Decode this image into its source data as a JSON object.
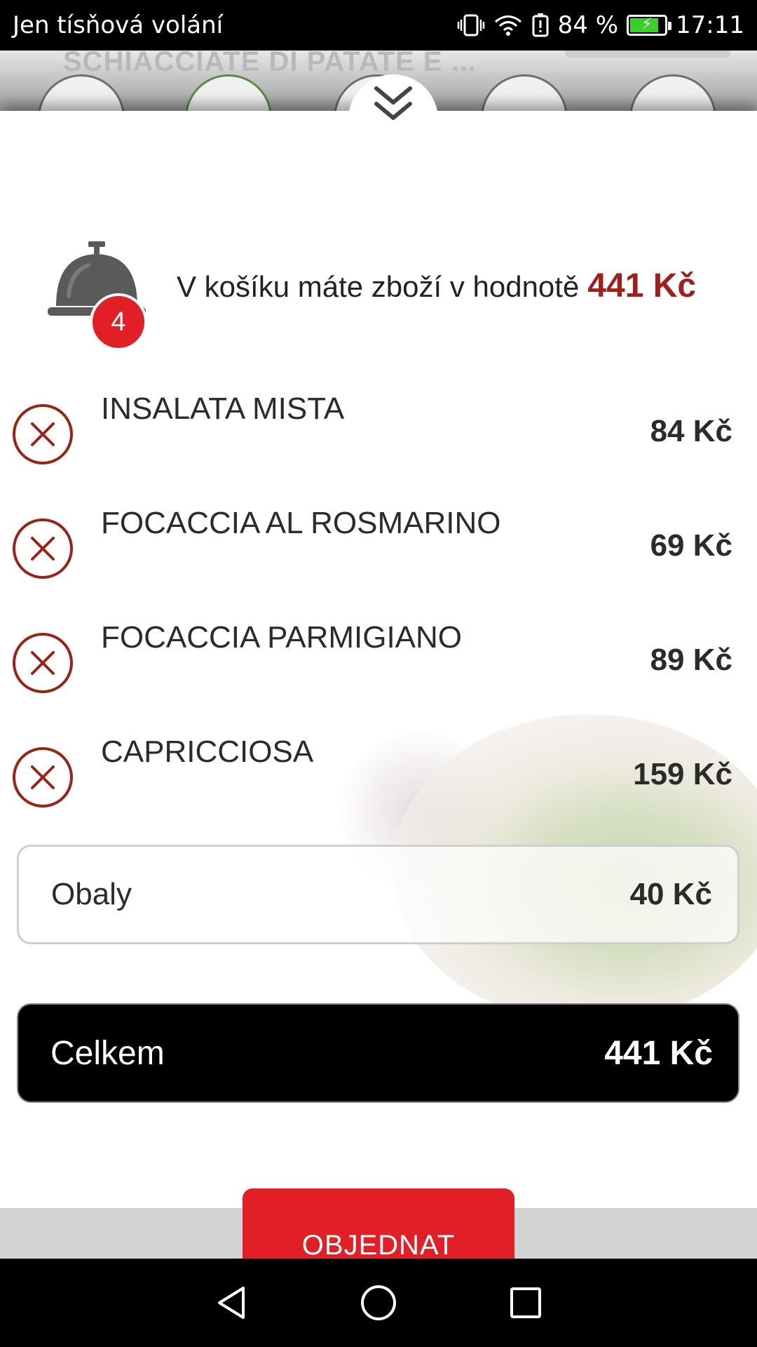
{
  "status_bar": {
    "carrier": "Jen tísňová volání",
    "battery_percent": "84 %",
    "time": "17:11",
    "battery_level": 0.84,
    "icons": [
      "vibrate-icon",
      "wifi-icon",
      "battery-alert-icon",
      "battery-icon"
    ]
  },
  "background_page": {
    "title": "SCHIACCIATE DI PATATE E ..."
  },
  "cart": {
    "count": "4",
    "summary_text": "V košíku máte zboží v hodnotě",
    "summary_value": "441 Kč",
    "accent_color": "#a11f18",
    "badge_color": "#e21f26"
  },
  "items": [
    {
      "name": "INSALATA MISTA",
      "price": "84 Kč"
    },
    {
      "name": "FOCACCIA AL ROSMARINO",
      "price": "69 Kč"
    },
    {
      "name": "FOCACCIA PARMIGIANO",
      "price": "89 Kč"
    },
    {
      "name": "CAPRICCIOSA",
      "price": "159 Kč"
    }
  ],
  "packaging": {
    "label": "Obaly",
    "price": "40 Kč"
  },
  "total": {
    "label": "Celkem",
    "price": "441 Kč"
  },
  "order_button": {
    "label": "OBJEDNAT",
    "color": "#e21f26"
  },
  "nav": {
    "icons": [
      "back-icon",
      "home-icon",
      "recents-icon"
    ]
  }
}
